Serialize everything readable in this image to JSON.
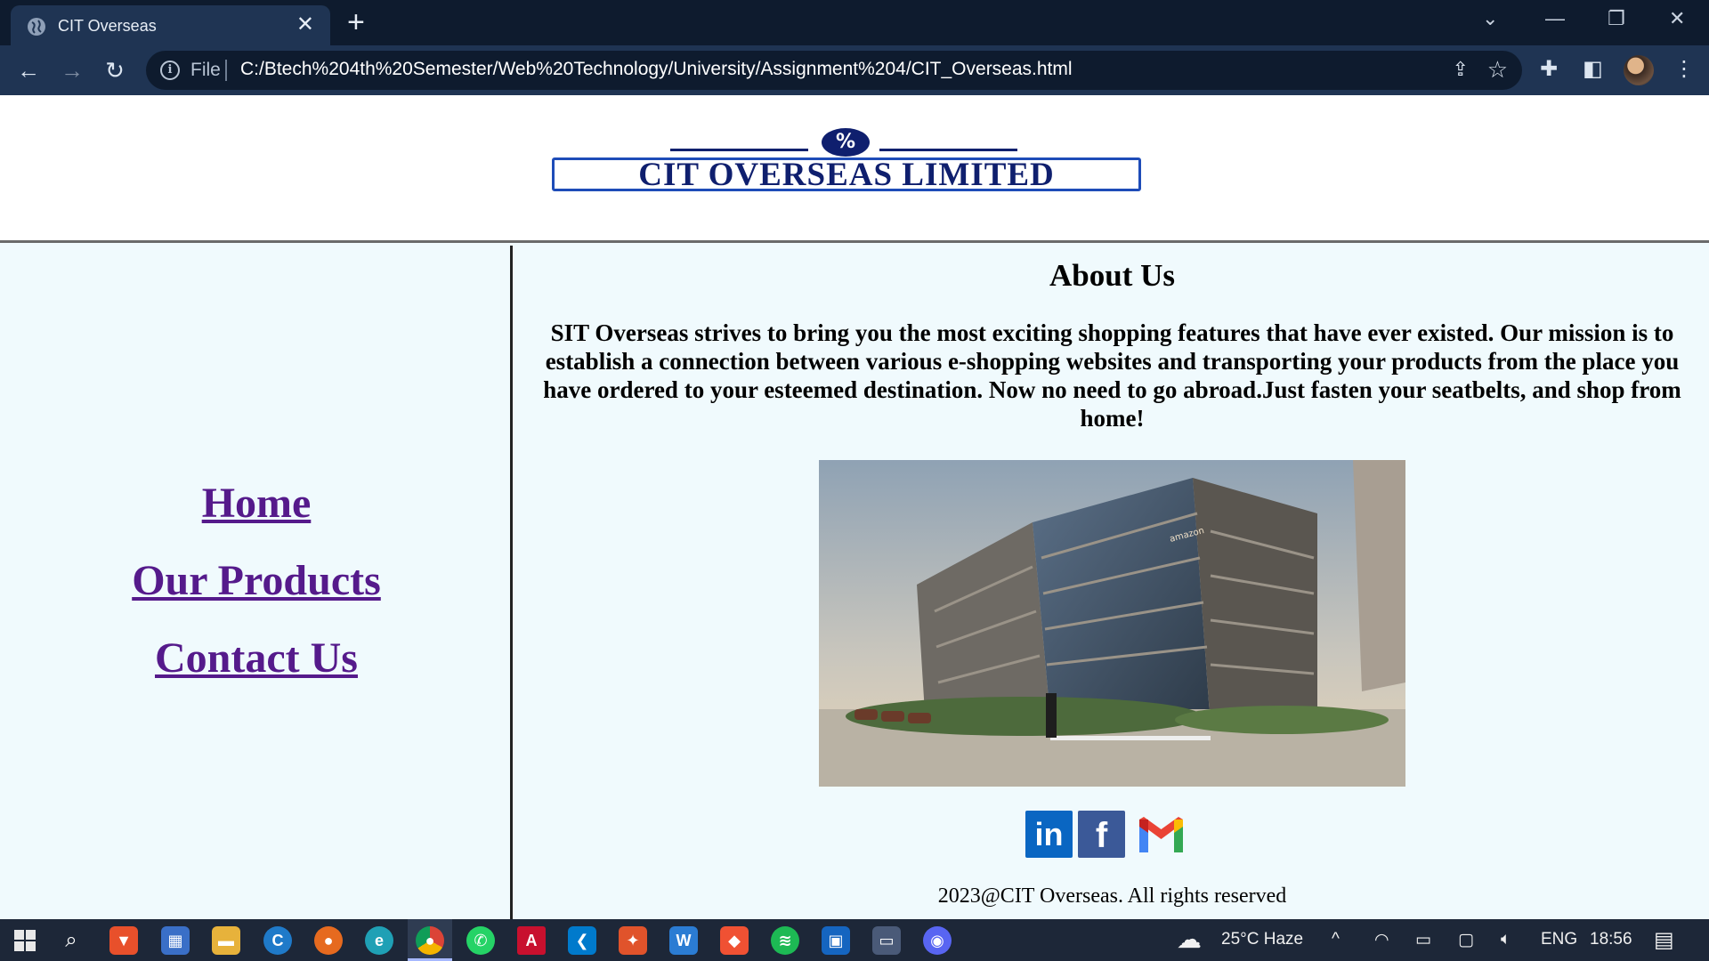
{
  "browser": {
    "tab_title": "CIT Overseas",
    "tab_close": "✕",
    "new_tab": "+",
    "url_scheme_label": "File",
    "url": "C:/Btech%204th%20Semester/Web%20Technology/University/Assignment%204/CIT_Overseas.html",
    "window_controls": {
      "list": "⌄",
      "minimize": "—",
      "restore": "❐",
      "close": "✕"
    },
    "nav": {
      "back": "←",
      "forward": "→",
      "reload": "↻"
    }
  },
  "header": {
    "logo_text": "CIT OVERSEAS LIMITED",
    "logo_emblem": "%"
  },
  "sidebar": {
    "links": [
      {
        "label": "Home"
      },
      {
        "label": "Our Products"
      },
      {
        "label": "Contact Us"
      }
    ]
  },
  "main": {
    "heading": "About Us",
    "paragraph": "SIT Overseas strives to bring you the most exciting shopping features that have ever existed. Our mission is to establish a connection between various e-shopping websites and transporting your products from the place you have ordered to your esteemed destination. Now no need to go abroad.Just fasten your seatbelts, and shop from home!",
    "photo_sign": "amazon",
    "social": {
      "linkedin": "in",
      "facebook": "f"
    },
    "copyright": "2023@CIT Overseas. All rights reserved"
  },
  "taskbar": {
    "weather": "25°C  Haze",
    "language": "ENG",
    "time": "18:56"
  },
  "colors": {
    "page_bg": "#f0fafd",
    "visited_link": "#551a8b",
    "tab_bar": "#0e1b2e",
    "toolbar": "#1f3453",
    "taskbar": "#1d2738"
  }
}
